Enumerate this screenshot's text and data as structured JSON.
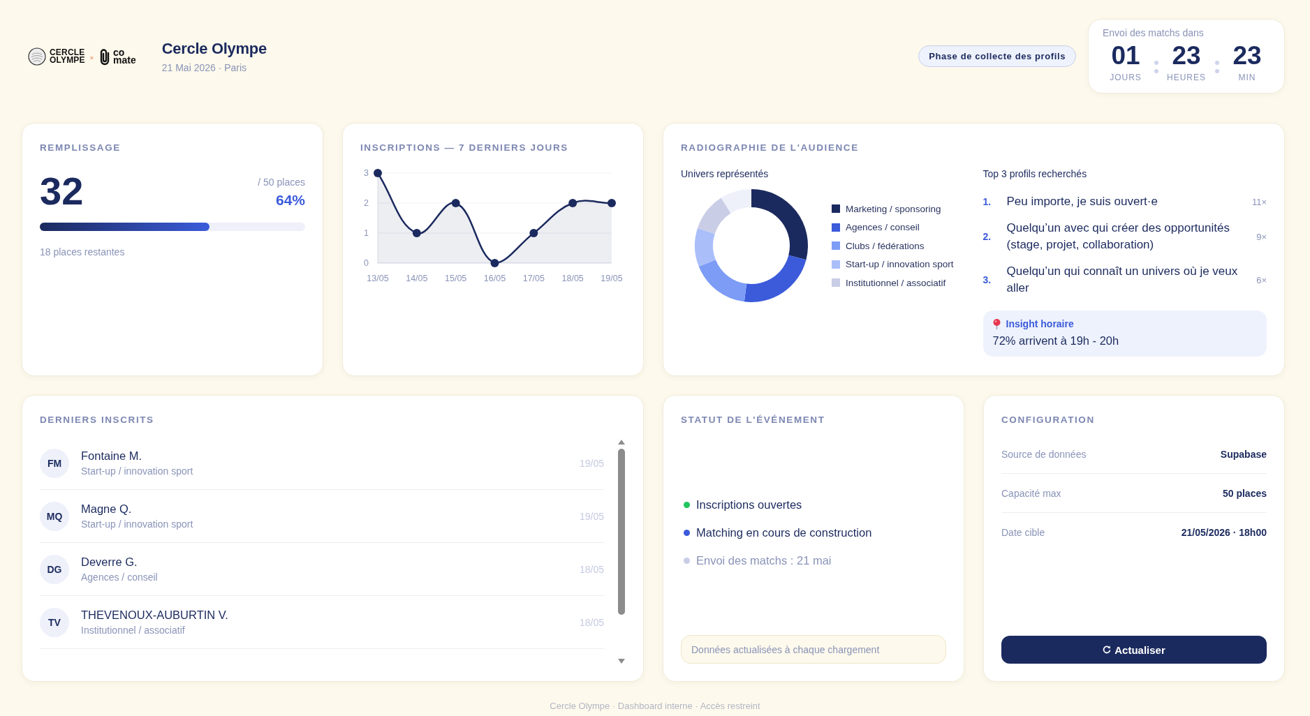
{
  "header": {
    "logo": {
      "primary": "CERCLE OLYMPE",
      "separator": "×",
      "partner": "co mate"
    },
    "title": "Cercle Olympe",
    "subtitle": "21 Mai 2026 · Paris",
    "phase": "Phase de collecte des profils",
    "countdown": {
      "label": "Envoi des matchs dans",
      "units": [
        {
          "value": "01",
          "label": "JOURS"
        },
        {
          "value": "23",
          "label": "HEURES"
        },
        {
          "value": "23",
          "label": "MIN"
        }
      ]
    }
  },
  "fill": {
    "title": "REMPLISSAGE",
    "count": "32",
    "capacity": "/ 50 places",
    "percent": "64%",
    "level": 0.64,
    "remaining": "18 places restantes"
  },
  "signups": {
    "title": "INSCRIPTIONS — 7 DERNIERS JOURS",
    "chart_data": {
      "type": "line",
      "categories": [
        "13/05",
        "14/05",
        "15/05",
        "16/05",
        "17/05",
        "18/05",
        "19/05"
      ],
      "series": [
        {
          "color": "#1b2a5e",
          "values": [
            3,
            1,
            2,
            0,
            1,
            2,
            2
          ],
          "marker": true
        }
      ],
      "ylim": [
        0,
        3
      ],
      "yticks": [
        0,
        1,
        2,
        3
      ]
    }
  },
  "audience": {
    "title": "RADIOGRAPHIE DE L'AUDIENCE",
    "chart_data": {
      "type": "donut",
      "title": "Univers représentés",
      "values": [
        29,
        23,
        17,
        11,
        11,
        9
      ],
      "colors": [
        "#1b2a5e",
        "#3b5bdb",
        "#7c9cf6",
        "#aabefa",
        "#c9cde6",
        "#eef0fa"
      ]
    },
    "legend": [
      {
        "label": "Marketing / sponsoring",
        "color": "#1b2a5e"
      },
      {
        "label": "Agences / conseil",
        "color": "#3b5bdb"
      },
      {
        "label": "Clubs / fédérations",
        "color": "#7c9cf6"
      },
      {
        "label": "Start-up / innovation sport",
        "color": "#aabefa"
      },
      {
        "label": "Institutionnel / associatif",
        "color": "#c9cde6"
      }
    ],
    "top_title": "Top 3 profils recherchés",
    "top_profiles": [
      {
        "rank": "1.",
        "text": "Peu importe, je suis ouvert·e",
        "count": "11×"
      },
      {
        "rank": "2.",
        "text": "Quelqu’un avec qui créer des opportunités (stage, projet, collaboration)",
        "count": "9×"
      },
      {
        "rank": "3.",
        "text": "Quelqu’un qui connaît un univers où je veux aller",
        "count": "6×"
      }
    ],
    "insight": {
      "title": "Insight horaire",
      "text": "72% arrivent à 19h - 20h"
    }
  },
  "recent": {
    "title": "DERNIERS INSCRITS",
    "rows": [
      {
        "initials": "FM",
        "name": "Fontaine M.",
        "category": "Start-up / innovation sport",
        "date": "19/05"
      },
      {
        "initials": "MQ",
        "name": "Magne Q.",
        "category": "Start-up / innovation sport",
        "date": "19/05"
      },
      {
        "initials": "DG",
        "name": "Deverre G.",
        "category": "Agences / conseil",
        "date": "18/05"
      },
      {
        "initials": "TV",
        "name": "THEVENOUX-AUBURTIN V.",
        "category": "Institutionnel / associatif",
        "date": "18/05"
      }
    ]
  },
  "status": {
    "title": "STATUT DE L'ÉVÉNEMENT",
    "items": [
      {
        "label": "Inscriptions ouvertes",
        "color": "#22c55e",
        "muted": false
      },
      {
        "label": "Matching en cours de construction",
        "color": "#3b5bdb",
        "muted": false
      },
      {
        "label": "Envoi des matchs : 21 mai",
        "color": "#c9cde6",
        "muted": true
      }
    ],
    "note": "Données actualisées à chaque chargement"
  },
  "config": {
    "title": "CONFIGURATION",
    "rows": [
      {
        "label": "Source de données",
        "value": "Supabase"
      },
      {
        "label": "Capacité max",
        "value": "50 places"
      },
      {
        "label": "Date cible",
        "value": "21/05/2026 · 18h00"
      }
    ],
    "button": "Actualiser"
  },
  "footer": "Cercle Olympe · Dashboard interne · Accès restreint"
}
